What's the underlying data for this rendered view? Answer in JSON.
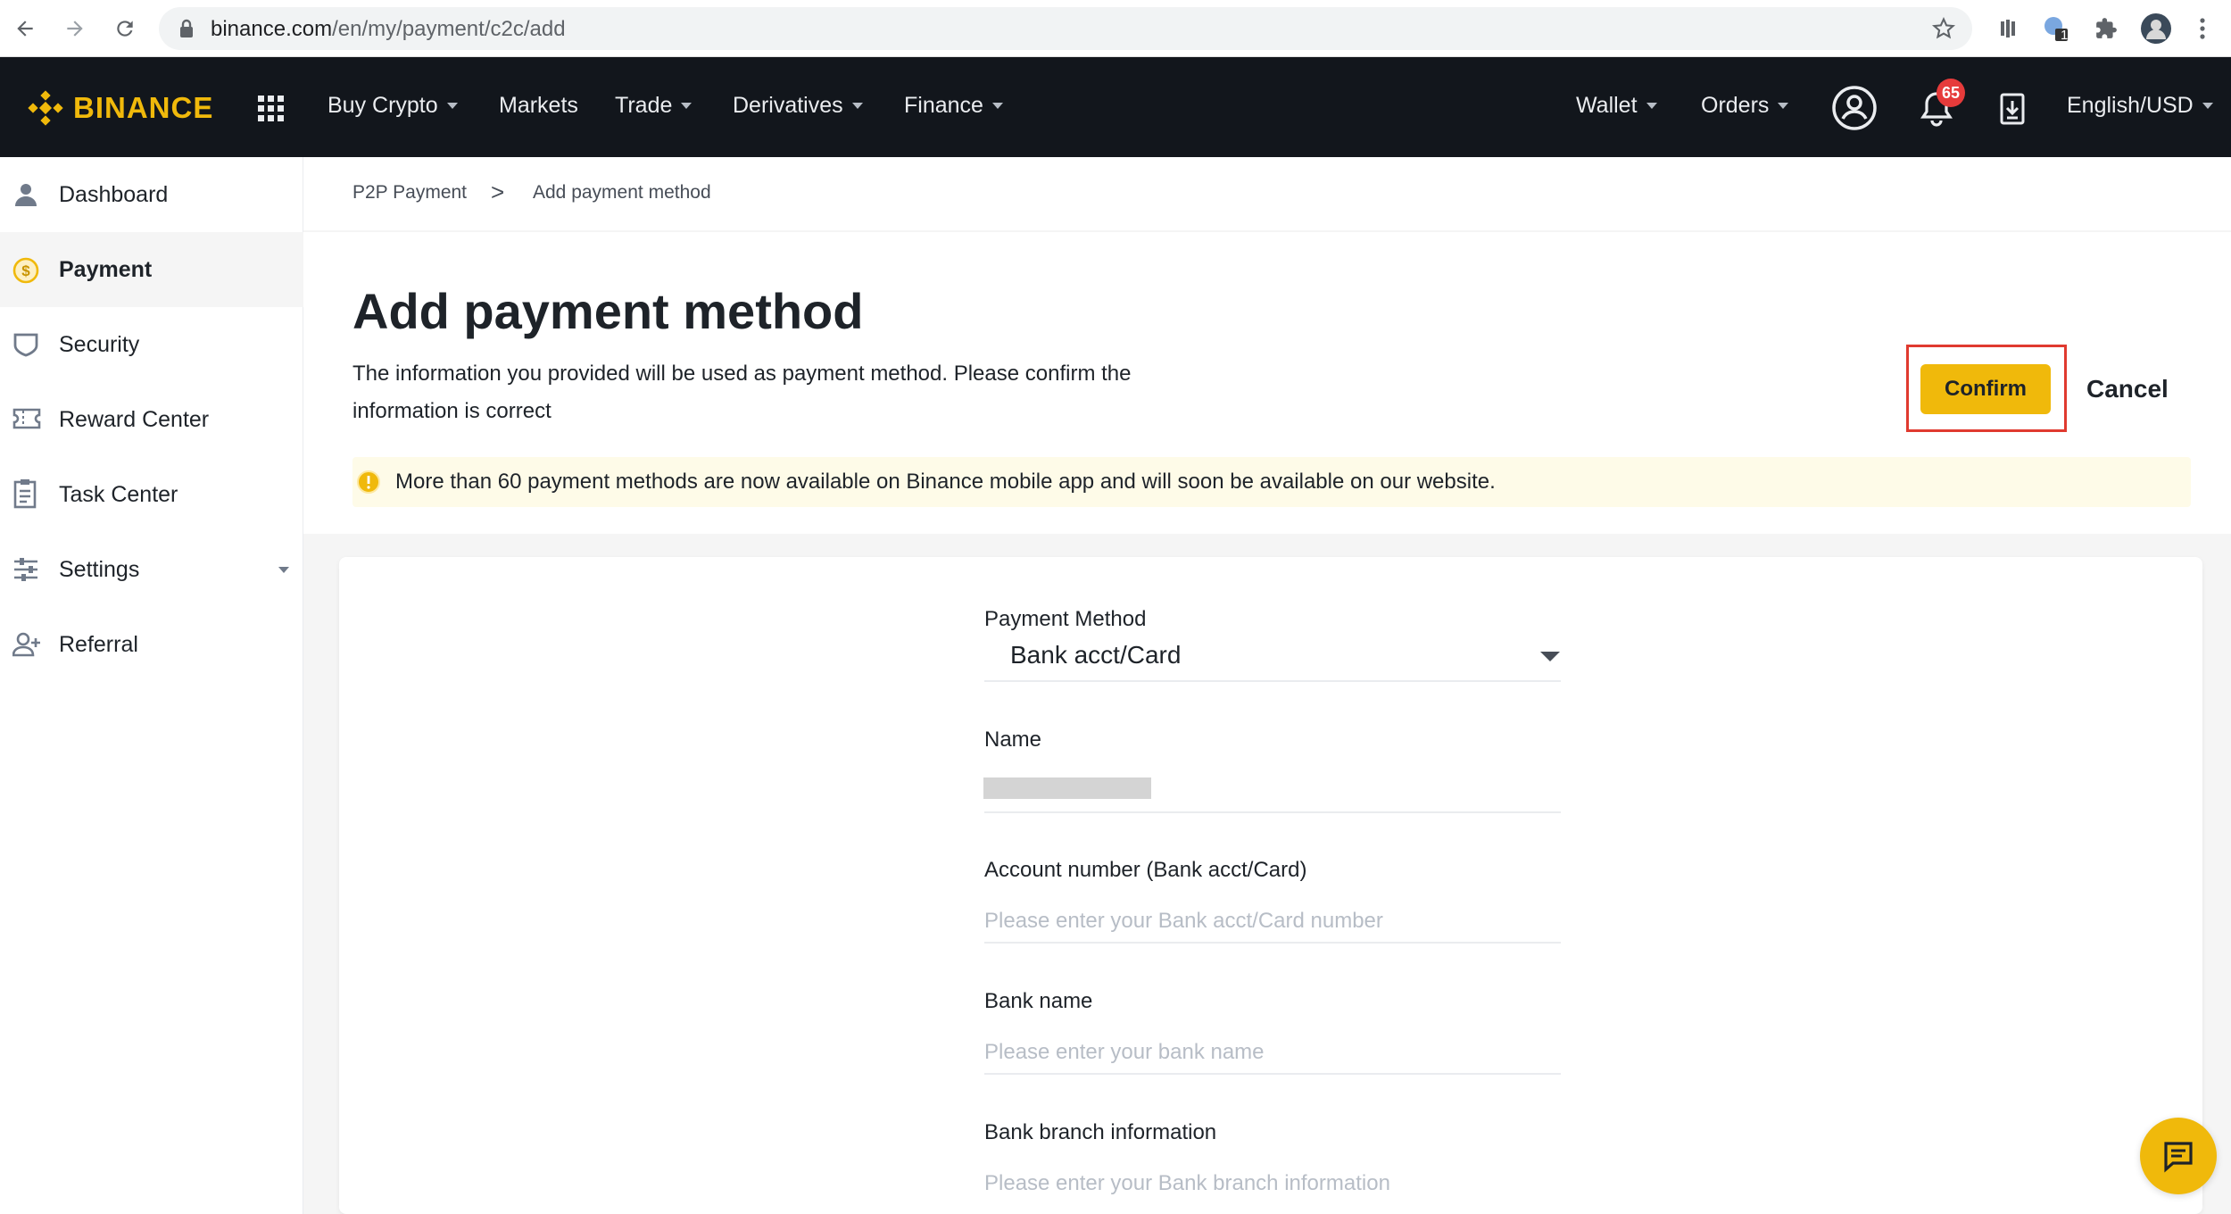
{
  "browser": {
    "url_host": "binance.com",
    "url_path": "/en/my/payment/c2c/add",
    "extension_badge": "1",
    "icons": [
      "back-arrow-icon",
      "forward-arrow-icon",
      "reload-icon",
      "lock-icon",
      "star-icon",
      "extension-icon",
      "puzzle-icon",
      "profile-avatar",
      "kebab-menu-icon"
    ]
  },
  "header": {
    "logo_text": "BINANCE",
    "nav": [
      {
        "label": "Buy Crypto",
        "has_caret": true
      },
      {
        "label": "Markets",
        "has_caret": false
      },
      {
        "label": "Trade",
        "has_caret": true
      },
      {
        "label": "Derivatives",
        "has_caret": true
      },
      {
        "label": "Finance",
        "has_caret": true
      }
    ],
    "right_nav": [
      {
        "label": "Wallet",
        "has_caret": true
      },
      {
        "label": "Orders",
        "has_caret": true
      }
    ],
    "notification_count": "65",
    "language": "English/USD"
  },
  "sidebar": {
    "items": [
      {
        "label": "Dashboard",
        "icon": "user-icon",
        "active": false
      },
      {
        "label": "Payment",
        "icon": "dollar-coin-icon",
        "active": true
      },
      {
        "label": "Security",
        "icon": "shield-icon",
        "active": false
      },
      {
        "label": "Reward Center",
        "icon": "ticket-icon",
        "active": false
      },
      {
        "label": "Task Center",
        "icon": "clipboard-icon",
        "active": false
      },
      {
        "label": "Settings",
        "icon": "sliders-icon",
        "active": false
      },
      {
        "label": "Referral",
        "icon": "add-user-icon",
        "active": false
      }
    ]
  },
  "breadcrumb": {
    "parent": "P2P Payment",
    "separator": ">",
    "current": "Add payment method"
  },
  "main": {
    "title": "Add payment method",
    "description": "The information you provided will be used as payment method. Please confirm the information is correct",
    "confirm_label": "Confirm",
    "cancel_label": "Cancel",
    "notice": "More than 60 payment methods are now available on Binance mobile app and will soon be available on our website."
  },
  "form": {
    "payment_method_label": "Payment Method",
    "payment_method_value": "Bank acct/Card",
    "name_label": "Name",
    "account_label": "Account number (Bank acct/Card)",
    "account_placeholder": "Please enter your Bank acct/Card number",
    "bank_name_label": "Bank name",
    "bank_name_placeholder": "Please enter your bank name",
    "branch_label": "Bank branch information",
    "branch_placeholder": "Please enter your Bank branch information"
  },
  "colors": {
    "brand_yellow": "#F0B90B",
    "header_bg": "#12161C",
    "highlight_red": "#E03A2F",
    "notice_bg": "#FEFBE8",
    "badge_red": "#E63B3B"
  }
}
